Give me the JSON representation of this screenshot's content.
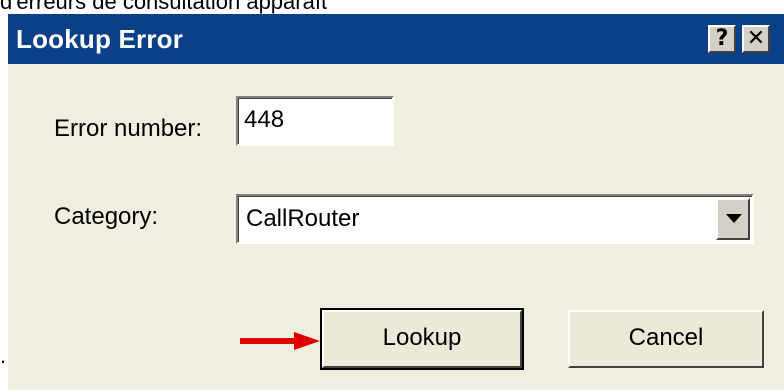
{
  "caption": "d'erreurs de consultation apparaît",
  "trailing_mark": ".",
  "dialog": {
    "title": "Lookup Error",
    "help_button": "?",
    "close_button": "✕",
    "error_number_label": "Error number:",
    "error_number_value": "448",
    "category_label": "Category:",
    "category_value": "CallRouter",
    "lookup_button": "Lookup",
    "cancel_button": "Cancel"
  },
  "colors": {
    "titlebar": "#0b3f87",
    "dialog_bg": "#f0eedf",
    "arrow": "#e00000"
  },
  "icons": {
    "help": "question-mark-icon",
    "close": "close-icon",
    "dropdown": "chevron-down-icon",
    "pointer": "red-arrow-icon"
  }
}
